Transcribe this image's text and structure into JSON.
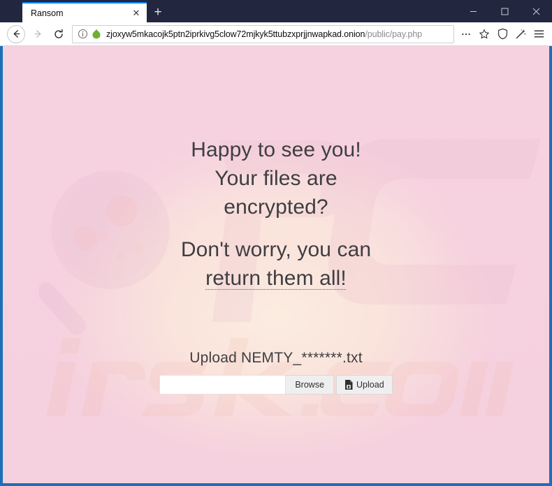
{
  "window": {
    "controls": {
      "minimize": "minimize-button",
      "maximize": "maximize-button",
      "close": "close-button"
    }
  },
  "browser": {
    "tab": {
      "title": "Ransom",
      "close_label": "✕"
    },
    "new_tab_label": "+",
    "nav": {
      "back_label": "back",
      "forward_label": "forward",
      "reload_label": "reload"
    },
    "url": {
      "host": "zjoxyw5mkacojk5ptn2iprkivg5clow72mjkyk5ttubzxprjjnwapkad.onion",
      "path": "/public/pay.php",
      "info_icon": "info-circle-icon",
      "site_icon": "onion-icon"
    },
    "toolbar_icons": {
      "page_actions": "ellipsis-icon",
      "bookmark": "star-icon",
      "shield": "shield-icon",
      "pocket": "pocket-wand-icon",
      "menu": "hamburger-menu-icon"
    }
  },
  "page": {
    "headline": {
      "line1": "Happy to see you!",
      "line2": "Your files are",
      "line3": "encrypted?",
      "line4": "Don't worry, you can ",
      "line5": "return them all!"
    },
    "upload": {
      "label": "Upload NEMTY_*******.txt",
      "file_value": "",
      "file_placeholder": "",
      "browse_label": "Browse",
      "upload_label": "Upload",
      "upload_icon": "file-upload-icon"
    },
    "watermark": {
      "brand": "risk.com",
      "logo": "PC"
    },
    "colors": {
      "background_pink": "#f5d0de",
      "background_cream": "#fae8dc",
      "text": "#3e3e42",
      "frame_blue": "#1d6fb8",
      "titlebar": "#22263f",
      "tab_accent": "#0a84ff"
    }
  }
}
